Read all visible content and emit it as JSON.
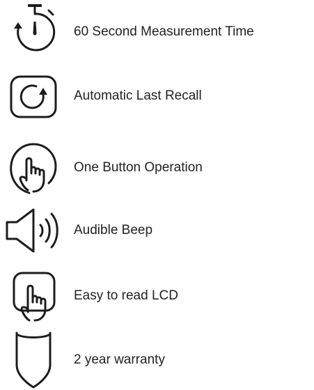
{
  "features": [
    {
      "icon": "stopwatch-icon",
      "label": "60 Second Measurement Time"
    },
    {
      "icon": "recall-arrow-icon",
      "label": "Automatic Last Recall"
    },
    {
      "icon": "pointing-hand-icon",
      "label": "One Button Operation"
    },
    {
      "icon": "speaker-icon",
      "label": "Audible Beep"
    },
    {
      "icon": "finger-press-icon",
      "label": "Easy to read LCD"
    },
    {
      "icon": "shield-icon",
      "label": "2 year warranty"
    }
  ],
  "colors": {
    "text": "#222222",
    "icon_stroke": "#1c1c1c",
    "background": "#ffffff"
  }
}
